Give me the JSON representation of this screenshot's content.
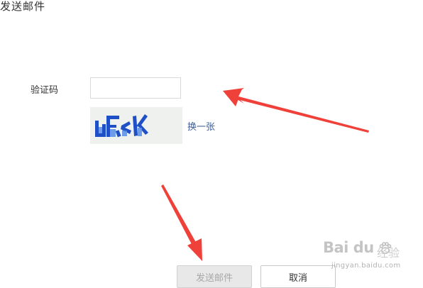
{
  "dialog": {
    "title": "发送邮件"
  },
  "form": {
    "captcha_label": "验证码",
    "captcha_input_value": "",
    "captcha_input_placeholder": "",
    "captcha_image_text": "uFcK",
    "refresh_label": "换一张"
  },
  "actions": {
    "send_label": "发送邮件",
    "cancel_label": "取消"
  },
  "annotations": {
    "arrow_color": "#f0403a"
  },
  "watermark": {
    "brand": "Bai du",
    "brand_cn": "经验",
    "domain": "jingyan.baidu.com"
  }
}
